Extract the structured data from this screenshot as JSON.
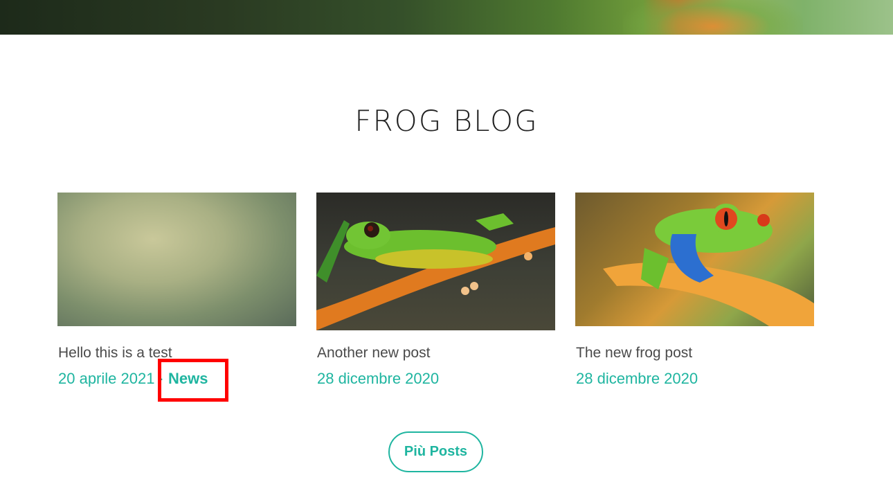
{
  "section": {
    "title": "FROG BLOG"
  },
  "posts": [
    {
      "title": "Hello this is a test",
      "date": "20 aprile 2021",
      "separator": "·",
      "category": "News"
    },
    {
      "title": "Another new post",
      "date": "28 dicembre 2020"
    },
    {
      "title": "The new frog post",
      "date": "28 dicembre 2020"
    }
  ],
  "more_button": {
    "label": "Più Posts"
  },
  "colors": {
    "accent": "#1fb5a0",
    "title_text": "#222222",
    "body_text": "#4a4a4a",
    "highlight": "#ff0000"
  }
}
